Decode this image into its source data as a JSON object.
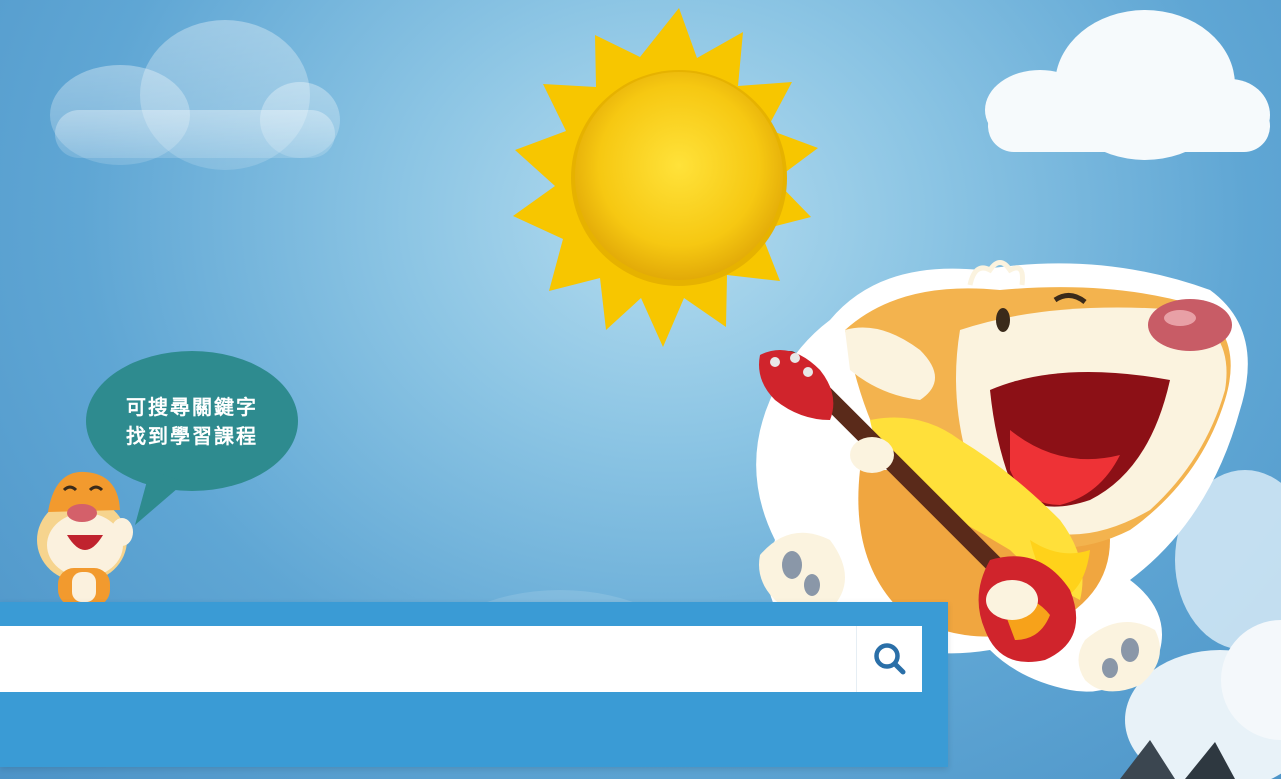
{
  "hint_bubble": {
    "line1": "可搜尋關鍵字",
    "line2": "找到學習課程"
  },
  "search": {
    "placeholder": "",
    "value": "",
    "button_icon": "search-icon"
  },
  "colors": {
    "sky": "#5fa6d4",
    "search_band": "#3a9bd5",
    "bubble": "#2e8b8f",
    "sun": "#f5c518",
    "accent_icon": "#2a6fa8"
  }
}
